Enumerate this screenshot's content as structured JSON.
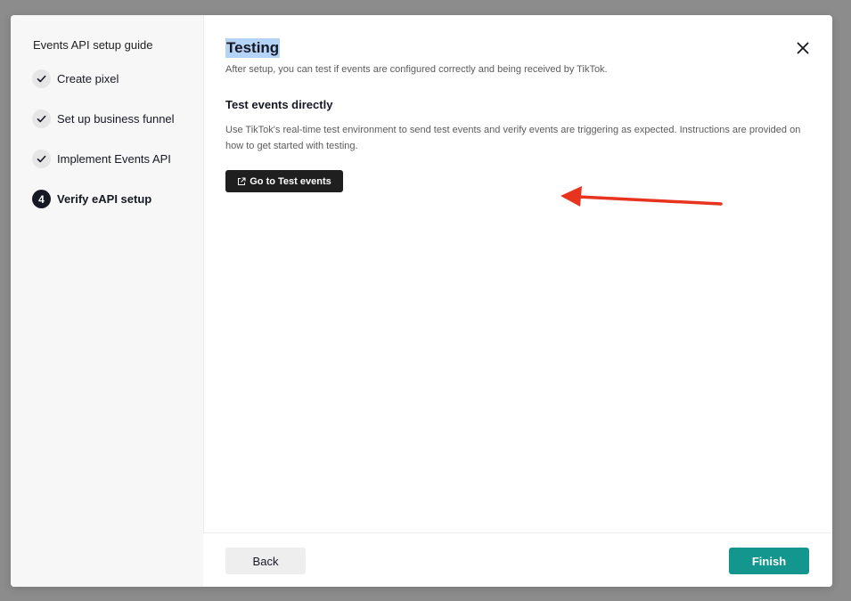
{
  "sidebar": {
    "title": "Events API setup guide",
    "steps": [
      {
        "label": "Create pixel",
        "status": "done"
      },
      {
        "label": "Set up business funnel",
        "status": "done"
      },
      {
        "label": "Implement Events API",
        "status": "done"
      },
      {
        "label": "Verify eAPI setup",
        "status": "current",
        "number": "4"
      }
    ]
  },
  "main": {
    "title": "Testing",
    "subtitle": "After setup, you can test if events are configured correctly and being received by TikTok.",
    "section": {
      "heading": "Test events directly",
      "description": "Use TikTok's real-time test environment to send test events and verify events are triggering as expected. Instructions are provided on how to get started with testing.",
      "button_label": "Go to Test events"
    }
  },
  "footer": {
    "back_label": "Back",
    "finish_label": "Finish"
  },
  "colors": {
    "accent": "#13968e",
    "dark": "#161823",
    "annotation_arrow": "#e8331f",
    "selection_highlight": "#b5d3f7"
  },
  "icons": {
    "done": "check-icon",
    "close": "close-icon",
    "external": "external-link-icon"
  }
}
